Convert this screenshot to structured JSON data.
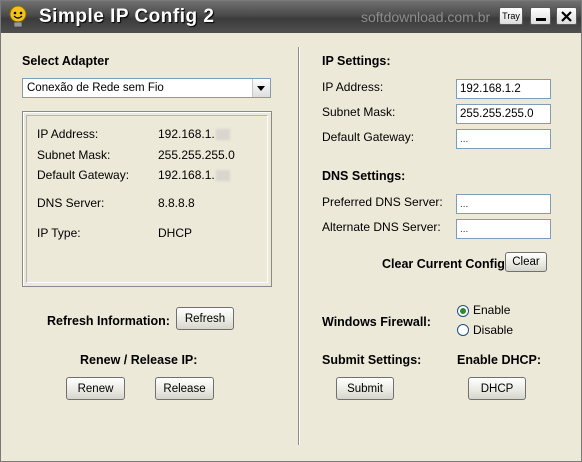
{
  "titlebar": {
    "title": "Simple IP Config 2",
    "watermark": "softdownload.com.br",
    "tray_label": "Tray",
    "logo_icon": "lightbulb-face-icon"
  },
  "left": {
    "select_adapter_label": "Select Adapter",
    "adapter_selected": "Conexão de Rede sem Fio",
    "info": {
      "ip_label": "IP Address:",
      "ip_value": "192.168.1.",
      "mask_label": "Subnet Mask:",
      "mask_value": "255.255.255.0",
      "gateway_label": "Default Gateway:",
      "gateway_value": "192.168.1.",
      "dns_label": "DNS Server:",
      "dns_value": "8.8.8.8",
      "type_label": "IP Type:",
      "type_value": "DHCP"
    },
    "refresh_label": "Refresh Information:",
    "refresh_button": "Refresh",
    "renew_release_label": "Renew / Release IP:",
    "renew_button": "Renew",
    "release_button": "Release"
  },
  "right": {
    "ip_settings_label": "IP Settings:",
    "ip_address_label": "IP Address:",
    "ip_address_value": "192.168.1.2",
    "subnet_mask_label": "Subnet Mask:",
    "subnet_mask_value": "255.255.255.0",
    "default_gateway_label": "Default Gateway:",
    "default_gateway_value": "...",
    "dns_settings_label": "DNS Settings:",
    "preferred_dns_label": "Preferred DNS Server:",
    "preferred_dns_value": "...",
    "alternate_dns_label": "Alternate DNS Server:",
    "alternate_dns_value": "...",
    "clear_config_label": "Clear Current Config:",
    "clear_button": "Clear",
    "firewall_label": "Windows Firewall:",
    "firewall_enable": "Enable",
    "firewall_disable": "Disable",
    "firewall_selected": "Enable",
    "submit_settings_label": "Submit Settings:",
    "submit_button": "Submit",
    "enable_dhcp_label": "Enable DHCP:",
    "dhcp_button": "DHCP"
  }
}
